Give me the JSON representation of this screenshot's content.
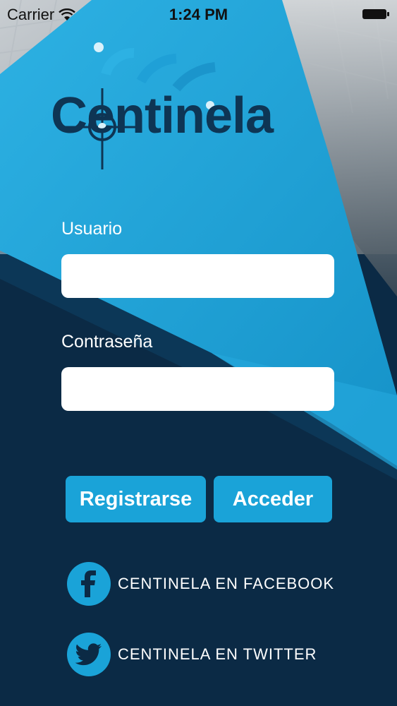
{
  "status_bar": {
    "carrier": "Carrier",
    "time": "1:24 PM"
  },
  "logo": {
    "text": "Centinela"
  },
  "form": {
    "username_label": "Usuario",
    "username_value": "",
    "password_label": "Contraseña",
    "password_value": ""
  },
  "buttons": {
    "register": "Registrarse",
    "login": "Acceder"
  },
  "social": {
    "facebook": "CENTINELA EN FACEBOOK",
    "twitter": "CENTINELA EN TWITTER"
  },
  "colors": {
    "accent": "#1aa3d8",
    "dark_navy": "#0b2a45",
    "logo_navy": "#0e3554",
    "light_blue": "#2db1e3"
  },
  "icons": {
    "wifi": "wifi-icon",
    "battery": "battery-icon",
    "facebook": "facebook-icon",
    "twitter": "twitter-icon"
  }
}
